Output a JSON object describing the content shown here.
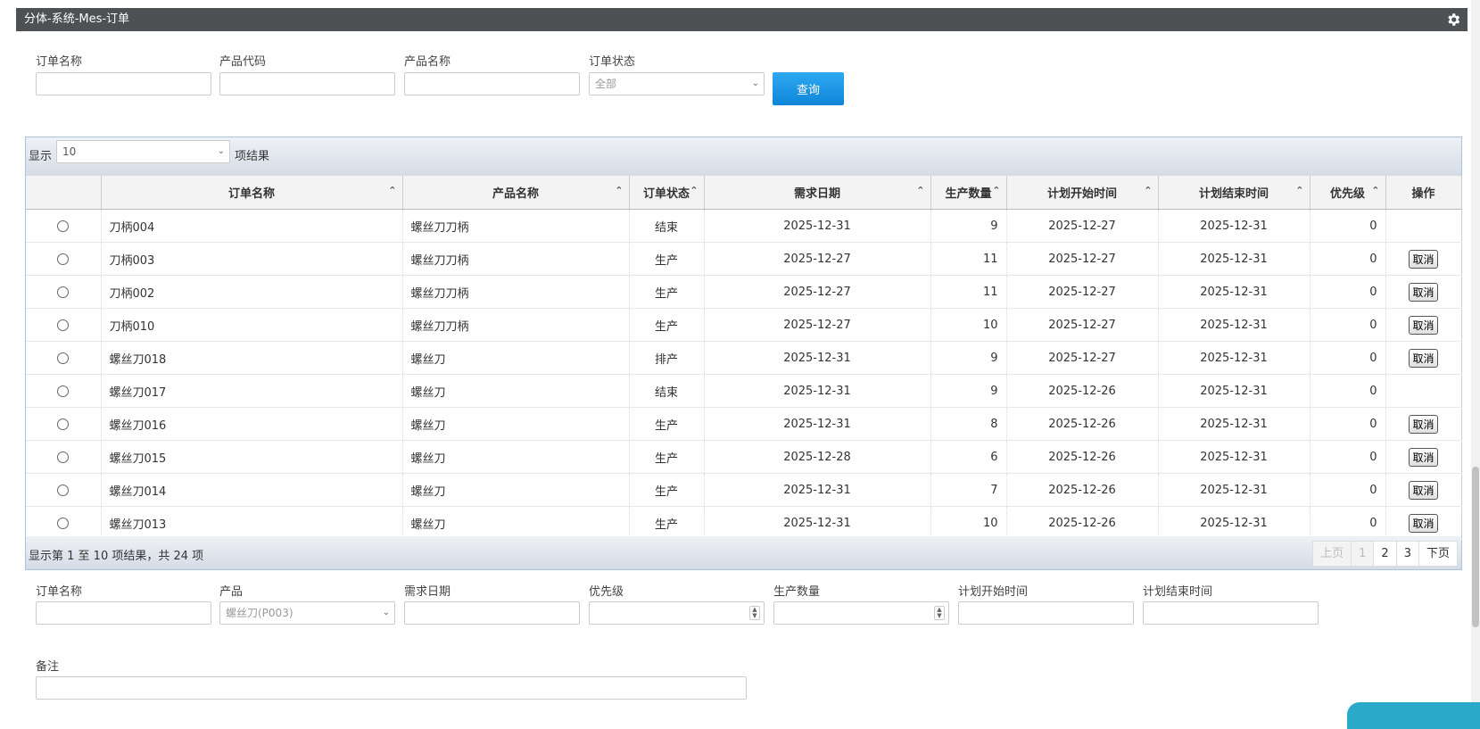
{
  "panel": {
    "title": "分体-系统-Mes-订单",
    "settings_icon": "gear-icon"
  },
  "search": {
    "order_name_label": "订单名称",
    "product_code_label": "产品代码",
    "product_name_label": "产品名称",
    "order_status_label": "订单状态",
    "order_status_value": "全部",
    "query_button": "查询"
  },
  "grid": {
    "show_label": "显示",
    "page_size": "10",
    "results_label": "项结果",
    "columns": [
      "订单名称",
      "产品名称",
      "订单状态",
      "需求日期",
      "生产数量",
      "计划开始时间",
      "计划结束时间",
      "优先级",
      "操作"
    ],
    "rows": [
      {
        "name": "刀柄004",
        "product": "螺丝刀刀柄",
        "status": "结束",
        "demand": "2025-12-31",
        "qty": "9",
        "start": "2025-12-27",
        "end": "2025-12-31",
        "priority": "0",
        "action": ""
      },
      {
        "name": "刀柄003",
        "product": "螺丝刀刀柄",
        "status": "生产",
        "demand": "2025-12-27",
        "qty": "11",
        "start": "2025-12-27",
        "end": "2025-12-31",
        "priority": "0",
        "action": "取消"
      },
      {
        "name": "刀柄002",
        "product": "螺丝刀刀柄",
        "status": "生产",
        "demand": "2025-12-27",
        "qty": "11",
        "start": "2025-12-27",
        "end": "2025-12-31",
        "priority": "0",
        "action": "取消"
      },
      {
        "name": "刀柄010",
        "product": "螺丝刀刀柄",
        "status": "生产",
        "demand": "2025-12-27",
        "qty": "10",
        "start": "2025-12-27",
        "end": "2025-12-31",
        "priority": "0",
        "action": "取消"
      },
      {
        "name": "螺丝刀018",
        "product": "螺丝刀",
        "status": "排产",
        "demand": "2025-12-31",
        "qty": "9",
        "start": "2025-12-27",
        "end": "2025-12-31",
        "priority": "0",
        "action": "取消"
      },
      {
        "name": "螺丝刀017",
        "product": "螺丝刀",
        "status": "结束",
        "demand": "2025-12-31",
        "qty": "9",
        "start": "2025-12-26",
        "end": "2025-12-31",
        "priority": "0",
        "action": ""
      },
      {
        "name": "螺丝刀016",
        "product": "螺丝刀",
        "status": "生产",
        "demand": "2025-12-31",
        "qty": "8",
        "start": "2025-12-26",
        "end": "2025-12-31",
        "priority": "0",
        "action": "取消"
      },
      {
        "name": "螺丝刀015",
        "product": "螺丝刀",
        "status": "生产",
        "demand": "2025-12-28",
        "qty": "6",
        "start": "2025-12-26",
        "end": "2025-12-31",
        "priority": "0",
        "action": "取消"
      },
      {
        "name": "螺丝刀014",
        "product": "螺丝刀",
        "status": "生产",
        "demand": "2025-12-31",
        "qty": "7",
        "start": "2025-12-26",
        "end": "2025-12-31",
        "priority": "0",
        "action": "取消"
      },
      {
        "name": "螺丝刀013",
        "product": "螺丝刀",
        "status": "生产",
        "demand": "2025-12-31",
        "qty": "10",
        "start": "2025-12-26",
        "end": "2025-12-31",
        "priority": "0",
        "action": "取消"
      }
    ],
    "info": "显示第 1 至 10 项结果，共 24 项",
    "pager": {
      "prev": "上页",
      "pages": [
        "1",
        "2",
        "3"
      ],
      "next": "下页"
    }
  },
  "form": {
    "order_name_label": "订单名称",
    "product_label": "产品",
    "product_value": "螺丝刀(P003)",
    "demand_date_label": "需求日期",
    "priority_label": "优先级",
    "qty_label": "生产数量",
    "start_label": "计划开始时间",
    "end_label": "计划结束时间",
    "remark_label": "备注"
  }
}
